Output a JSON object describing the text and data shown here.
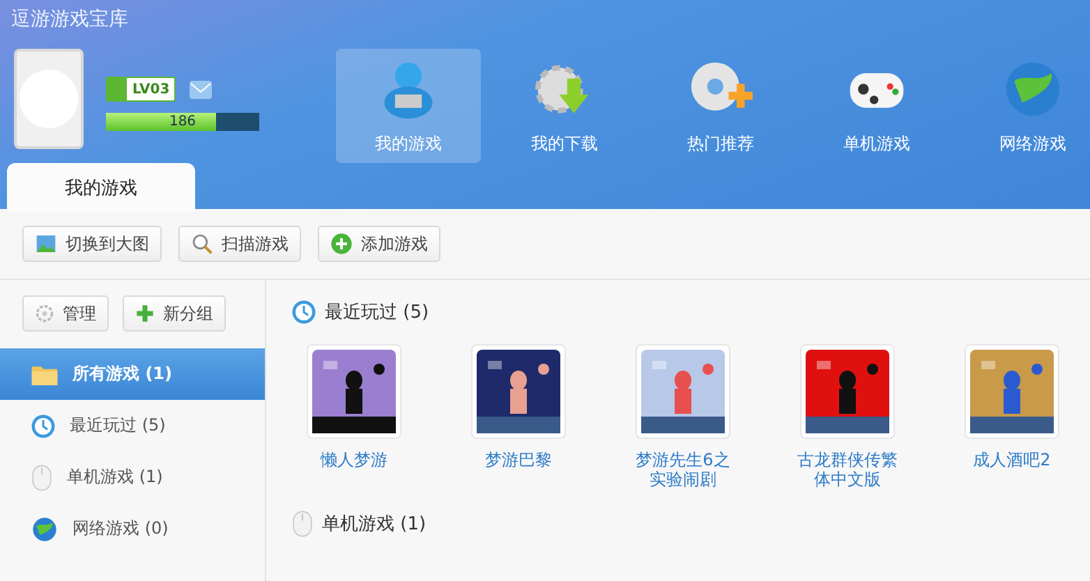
{
  "window": {
    "title": "逗游游戏宝库"
  },
  "user": {
    "level": "LV03",
    "xp": {
      "reading": "186",
      "level": 0.72
    }
  },
  "nav": [
    {
      "label": "我的游戏",
      "selected": true
    },
    {
      "label": "我的下载",
      "selected": false
    },
    {
      "label": "热门推荐",
      "selected": false
    },
    {
      "label": "单机游戏",
      "selected": false
    },
    {
      "label": "网络游戏",
      "selected": false
    }
  ],
  "tab": {
    "label": "我的游戏"
  },
  "toolbar": [
    {
      "label": "切换到大图"
    },
    {
      "label": "扫描游戏"
    },
    {
      "label": "添加游戏"
    }
  ],
  "sidebar": {
    "buttons": [
      {
        "label": "管理"
      },
      {
        "label": "新分组"
      }
    ],
    "items": [
      {
        "label": "所有游戏",
        "count": "(1)",
        "selected": true
      },
      {
        "label": "最近玩过",
        "count": "(5)",
        "selected": false
      },
      {
        "label": "单机游戏",
        "count": "(1)",
        "selected": false
      },
      {
        "label": "网络游戏",
        "count": "(0)",
        "selected": false
      }
    ]
  },
  "sections": [
    {
      "title": "最近玩过",
      "count": "(5)",
      "games": [
        {
          "title": "懒人梦游"
        },
        {
          "title": "梦游巴黎"
        },
        {
          "title": "梦游先生6之实验闹剧"
        },
        {
          "title": "古龙群侠传繁体中文版"
        },
        {
          "title": "成人酒吧2"
        }
      ]
    },
    {
      "title": "单机游戏",
      "count": "(1)"
    }
  ]
}
